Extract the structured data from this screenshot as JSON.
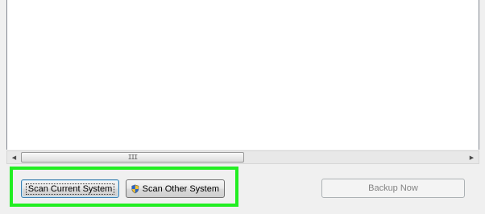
{
  "scrollbar": {
    "left_arrow": "◀",
    "right_arrow": "▶",
    "thumb_grip": "III"
  },
  "buttons": {
    "scan_current": "Scan Current System",
    "scan_other": "Scan Other System",
    "backup_now": "Backup Now"
  },
  "icons": {
    "scan_other_icon": "uac-shield-icon"
  },
  "colors": {
    "highlight_border": "#22ee22",
    "content_background": "#ffffff",
    "window_background": "#f0f0f0"
  }
}
